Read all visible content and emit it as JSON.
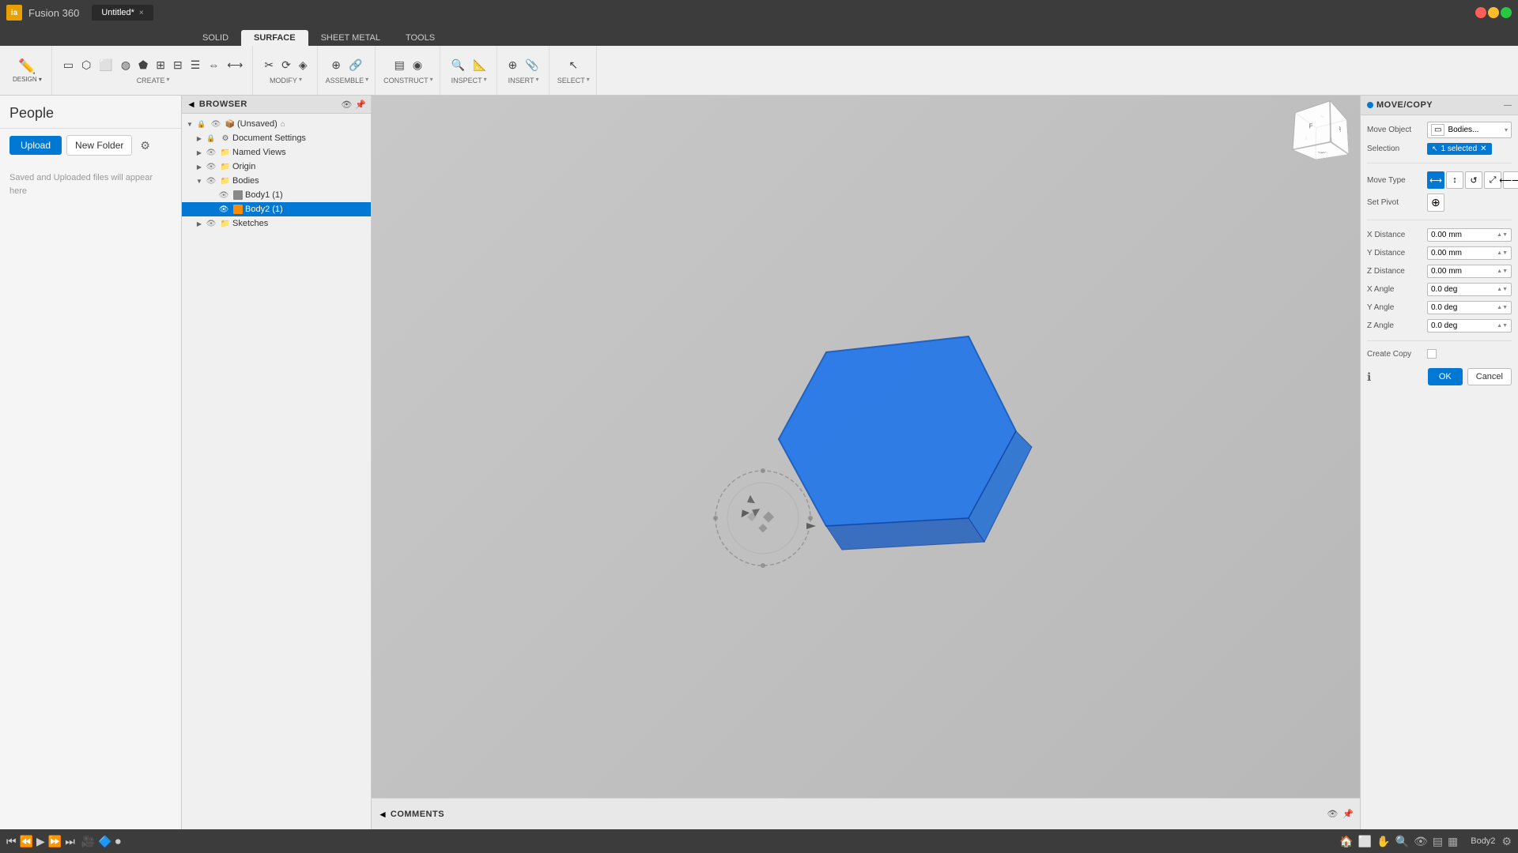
{
  "topbar": {
    "app_icon": "ia",
    "tab_label": "Untitled*",
    "tab_close": "×"
  },
  "ribbon": {
    "tabs": [
      "SOLID",
      "SURFACE",
      "SHEET METAL",
      "TOOLS"
    ],
    "active_tab": "SURFACE",
    "groups": {
      "create": {
        "label": "CREATE",
        "buttons": [
          {
            "icon": "▭",
            "label": ""
          },
          {
            "icon": "⬡",
            "label": ""
          },
          {
            "icon": "⬜",
            "label": ""
          },
          {
            "icon": "⬤",
            "label": ""
          },
          {
            "icon": "⬟",
            "label": ""
          },
          {
            "icon": "⊞",
            "label": ""
          },
          {
            "icon": "⊟",
            "label": ""
          },
          {
            "icon": "☇",
            "label": ""
          },
          {
            "icon": "⇥",
            "label": ""
          },
          {
            "icon": "⇱",
            "label": ""
          },
          {
            "icon": "⇲",
            "label": ""
          }
        ]
      },
      "modify": {
        "label": "MODIFY"
      },
      "assemble": {
        "label": "ASSEMBLE"
      },
      "construct": {
        "label": "CONSTRUCT"
      },
      "inspect": {
        "label": "INSPECT"
      },
      "insert": {
        "label": "INSERT"
      },
      "select": {
        "label": "SELECT"
      }
    }
  },
  "sidebar": {
    "title": "People",
    "upload_btn": "Upload",
    "new_folder_btn": "New Folder",
    "empty_msg": "Saved and Uploaded files will appear here"
  },
  "browser": {
    "title": "BROWSER",
    "root_label": "(Unsaved)",
    "items": [
      {
        "label": "Document Settings",
        "indent": 1,
        "type": "settings"
      },
      {
        "label": "Named Views",
        "indent": 1,
        "type": "folder"
      },
      {
        "label": "Origin",
        "indent": 1,
        "type": "folder"
      },
      {
        "label": "Bodies",
        "indent": 1,
        "type": "folder"
      },
      {
        "label": "Body1 (1)",
        "indent": 2,
        "type": "body"
      },
      {
        "label": "Body2 (1)",
        "indent": 2,
        "type": "body",
        "selected": true
      },
      {
        "label": "Sketches",
        "indent": 1,
        "type": "folder"
      }
    ]
  },
  "move_copy_panel": {
    "title": "MOVE/COPY",
    "move_object_label": "Move Object",
    "move_object_value": "Bodies...",
    "selection_label": "Selection",
    "selection_value": "1 selected",
    "move_type_label": "Move Type",
    "set_pivot_label": "Set Pivot",
    "x_distance_label": "X Distance",
    "x_distance_value": "0.00 mm",
    "y_distance_label": "Y Distance",
    "y_distance_value": "0.00 mm",
    "z_distance_label": "Z Distance",
    "z_distance_value": "0.00 mm",
    "x_angle_label": "X Angle",
    "x_angle_value": "0.0 deg",
    "y_angle_label": "Y Angle",
    "y_angle_value": "0.0 deg",
    "z_angle_label": "Z Angle",
    "z_angle_value": "0.0 deg",
    "create_copy_label": "Create Copy",
    "ok_btn": "OK",
    "cancel_btn": "Cancel"
  },
  "comments": {
    "title": "COMMENTS"
  },
  "status": {
    "body_label": "Body2"
  },
  "viewport_tools": [
    "🎯",
    "⬜",
    "✋",
    "🔍",
    "👁",
    "▤",
    "▦"
  ]
}
